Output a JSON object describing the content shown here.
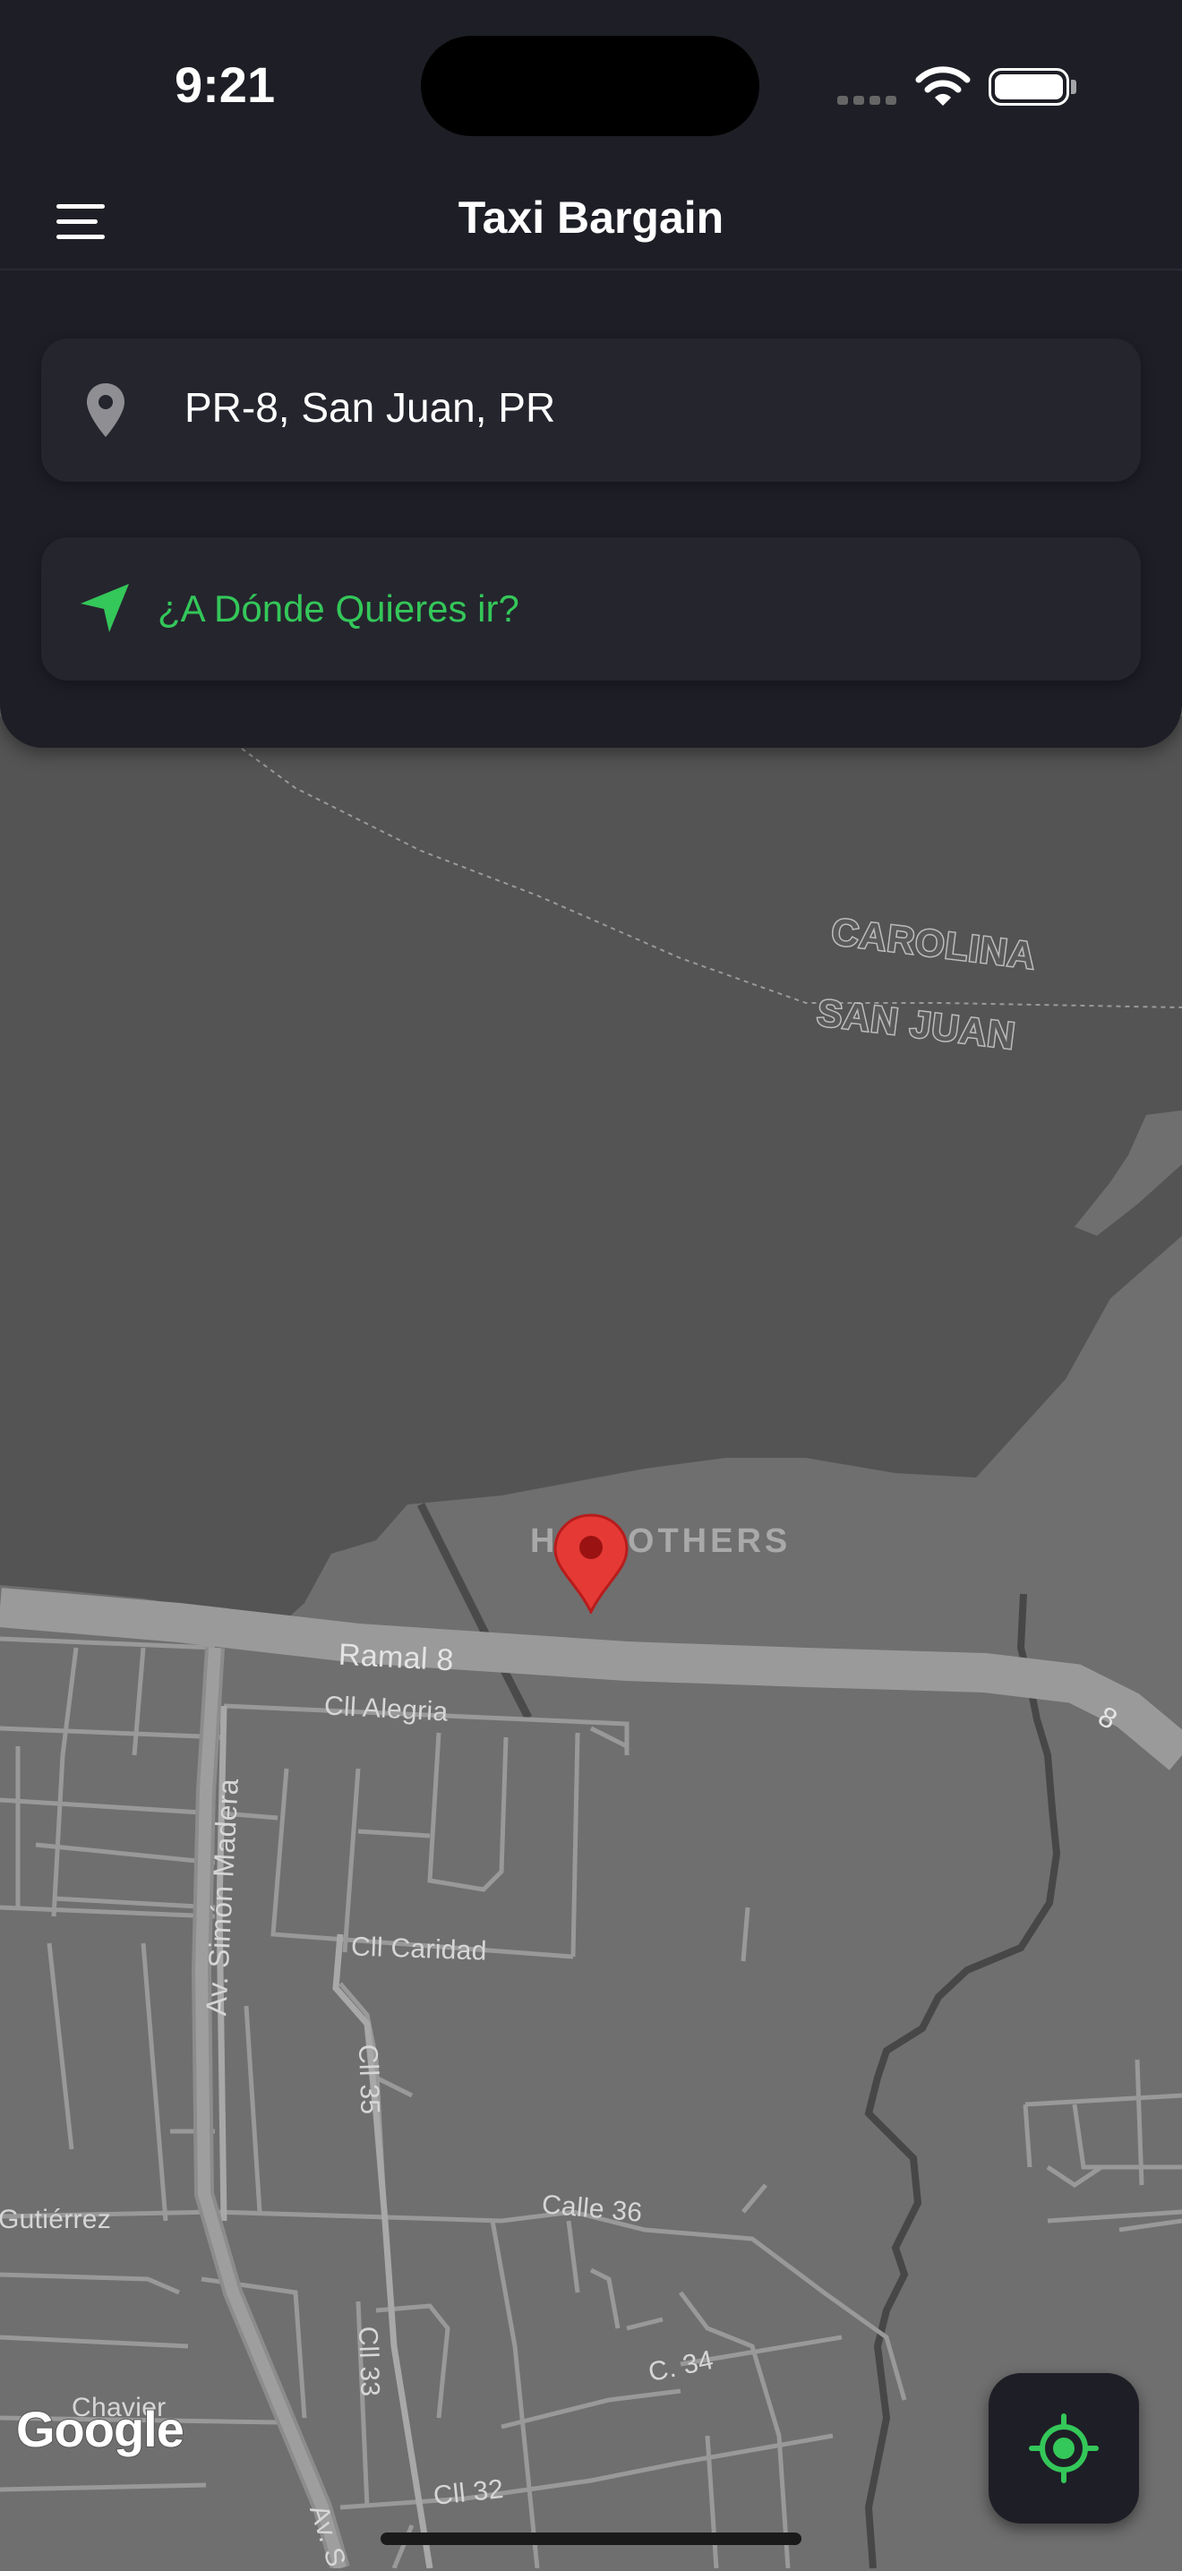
{
  "status_bar": {
    "time": "9:21",
    "icons": [
      "cellular-signal-icon",
      "wifi-icon",
      "battery-icon"
    ]
  },
  "header": {
    "title": "Taxi Bargain",
    "menu_icon": "hamburger-menu-icon"
  },
  "pickup": {
    "icon": "map-pin-icon",
    "value": "PR-8, San Juan, PR"
  },
  "destination": {
    "icon": "navigation-arrow-icon",
    "placeholder": "¿A Dónde Quieres ir?"
  },
  "map": {
    "regions": [
      "CAROLINA",
      "SAN JUAN"
    ],
    "poi": "H BROTHERS",
    "streets": {
      "ramal": "Ramal 8",
      "route_shield": "8",
      "alegria": "Cll Alegria",
      "simon_madera": "Av. Simón Madera",
      "caridad": "Cll Caridad",
      "cll35": "Cll 35",
      "calle36": "Calle 36",
      "gutierrez": "Gutiérrez",
      "cll33": "Cll 33",
      "c34": "C. 34",
      "chavier": "Chavier",
      "cll32": "Cll 32",
      "av_s": "Av. S"
    },
    "attribution": "Google"
  },
  "colors": {
    "accent": "#34c759",
    "panel": "#1e1e26",
    "field": "#25252e",
    "water": "#545454",
    "land": "#6f6f6f",
    "pin": "#e53935"
  },
  "controls": {
    "locate_icon": "my-location-icon"
  }
}
